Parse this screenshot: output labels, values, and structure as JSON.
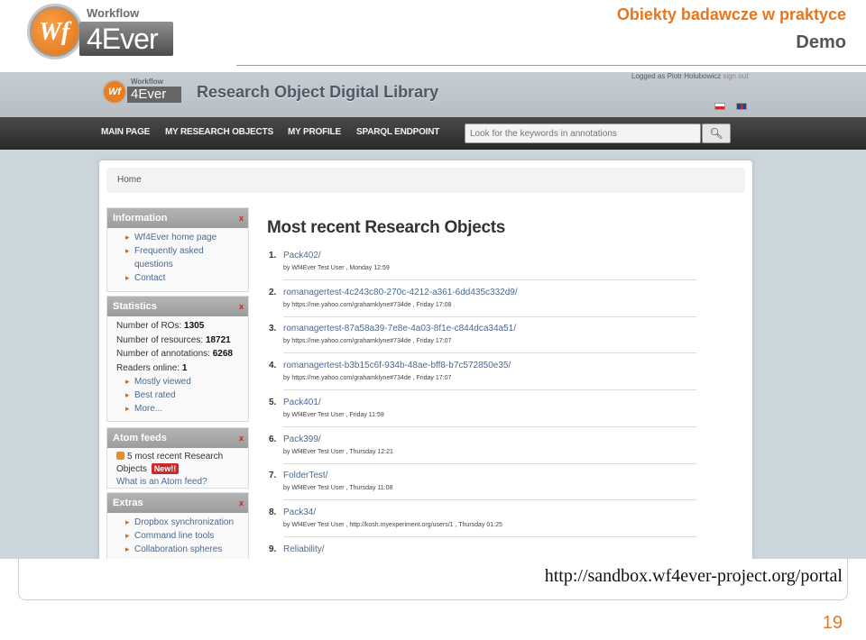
{
  "slide": {
    "logo_top": "Workflow",
    "logo_mark": "Wf",
    "logo_brand": "4Ever",
    "title": "Obiekty badawcze w praktyce",
    "subtitle": "Demo",
    "url": "http://sandbox.wf4ever-project.org/portal",
    "page_number": "19"
  },
  "app": {
    "logo_top": "Workflow",
    "logo_mark": "Wf",
    "logo_brand": "4Ever",
    "title": "Research Object Digital Library",
    "logged_in_text": "Logged as Piotr Holubowicz",
    "sign_out": "sign out",
    "languages": [
      "pl-flag-icon",
      "en-flag-icon"
    ]
  },
  "nav": {
    "items": [
      "MAIN PAGE",
      "MY RESEARCH OBJECTS",
      "MY PROFILE",
      "SPARQL ENDPOINT"
    ],
    "search_placeholder": "Look for the keywords in annotations",
    "search_icon": "search-icon"
  },
  "breadcrumb": "Home",
  "sidebar": {
    "information": {
      "title": "Information",
      "close": "x",
      "links": [
        "Wf4Ever home page",
        "Frequently asked",
        "questions",
        "Contact"
      ]
    },
    "statistics": {
      "title": "Statistics",
      "close": "x",
      "ros_label": "Number of ROs:",
      "ros_value": "1305",
      "resources_label": "Number of resources:",
      "resources_value": "18721",
      "annotations_label": "Number of annotations:",
      "annotations_value": "6268",
      "readers_label": "Readers online:",
      "readers_value": "1",
      "links": [
        "Mostly viewed",
        "Best rated",
        "More..."
      ]
    },
    "atom": {
      "title": "Atom feeds",
      "close": "x",
      "feed_line1": "5 most recent Research",
      "feed_line2": "Objects",
      "new_badge": "New!!",
      "what_is": "What is an Atom feed?"
    },
    "extras": {
      "title": "Extras",
      "close": "x",
      "links": [
        "Dropbox synchronization",
        "Command line tools",
        "Collaboration spheres"
      ]
    }
  },
  "main": {
    "title": "Most recent Research Objects",
    "items": [
      {
        "num": "1.",
        "name": "Pack402/",
        "meta": "by Wf4Ever Test User , Monday 12:59"
      },
      {
        "num": "2.",
        "name": "romanagertest-4c243c80-270c-4212-a361-6dd435c332d9/",
        "meta": "by https://me.yahoo.com/grahamklyne#734de , Friday 17:08"
      },
      {
        "num": "3.",
        "name": "romanagertest-87a58a39-7e8e-4a03-8f1e-c844dca34a51/",
        "meta": "by https://me.yahoo.com/grahamklyne#734de , Friday 17:07"
      },
      {
        "num": "4.",
        "name": "romanagertest-b3b15c6f-934b-48ae-bff8-b7c572850e35/",
        "meta": "by https://me.yahoo.com/grahamklyne#734de , Friday 17:07"
      },
      {
        "num": "5.",
        "name": "Pack401/",
        "meta": "by Wf4Ever Test User , Friday 11:59"
      },
      {
        "num": "6.",
        "name": "Pack399/",
        "meta": "by Wf4Ever Test User , Thursday 12:21"
      },
      {
        "num": "7.",
        "name": "FolderTest/",
        "meta": "by Wf4Ever Test User , Thursday 11:08"
      },
      {
        "num": "8.",
        "name": "Pack34/",
        "meta": "by Wf4Ever Test User , http://kosh.myexperiment.org/users/1 , Thursday 01:25"
      },
      {
        "num": "9.",
        "name": "Reliability/",
        "meta": ""
      }
    ]
  }
}
